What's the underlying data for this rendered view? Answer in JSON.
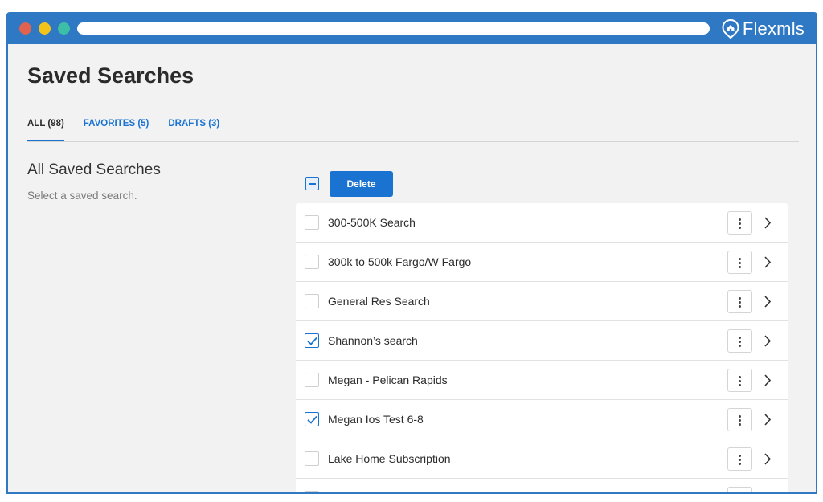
{
  "browser": {
    "brand_name": "Flexmls"
  },
  "page": {
    "title": "Saved Searches"
  },
  "tabs": [
    {
      "label": "ALL (98)",
      "active": true
    },
    {
      "label": "FAVORITES (5)",
      "active": false
    },
    {
      "label": "DRAFTS (3)",
      "active": false
    }
  ],
  "section": {
    "title": "All Saved Searches",
    "subtitle": "Select a saved search."
  },
  "toolbar": {
    "delete_label": "Delete"
  },
  "searches": [
    {
      "name": "300-500K Search",
      "checked": false
    },
    {
      "name": "300k to 500k Fargo/W Fargo",
      "checked": false
    },
    {
      "name": "General Res Search",
      "checked": false
    },
    {
      "name": "Shannon’s search",
      "checked": true
    },
    {
      "name": "Megan - Pelican Rapids",
      "checked": false
    },
    {
      "name": "Megan Ios Test 6-8",
      "checked": true
    },
    {
      "name": "Lake Home Subscription",
      "checked": false
    }
  ],
  "colors": {
    "accent": "#1a73d1",
    "titlebar": "#2f78c4",
    "background": "#f2f2f2"
  },
  "icons": [
    "window-close-dot",
    "window-minimize-dot",
    "window-maximize-dot",
    "flexmls-logo-icon",
    "more-vertical-icon",
    "chevron-right-icon",
    "checkmark-icon",
    "minus-icon"
  ]
}
